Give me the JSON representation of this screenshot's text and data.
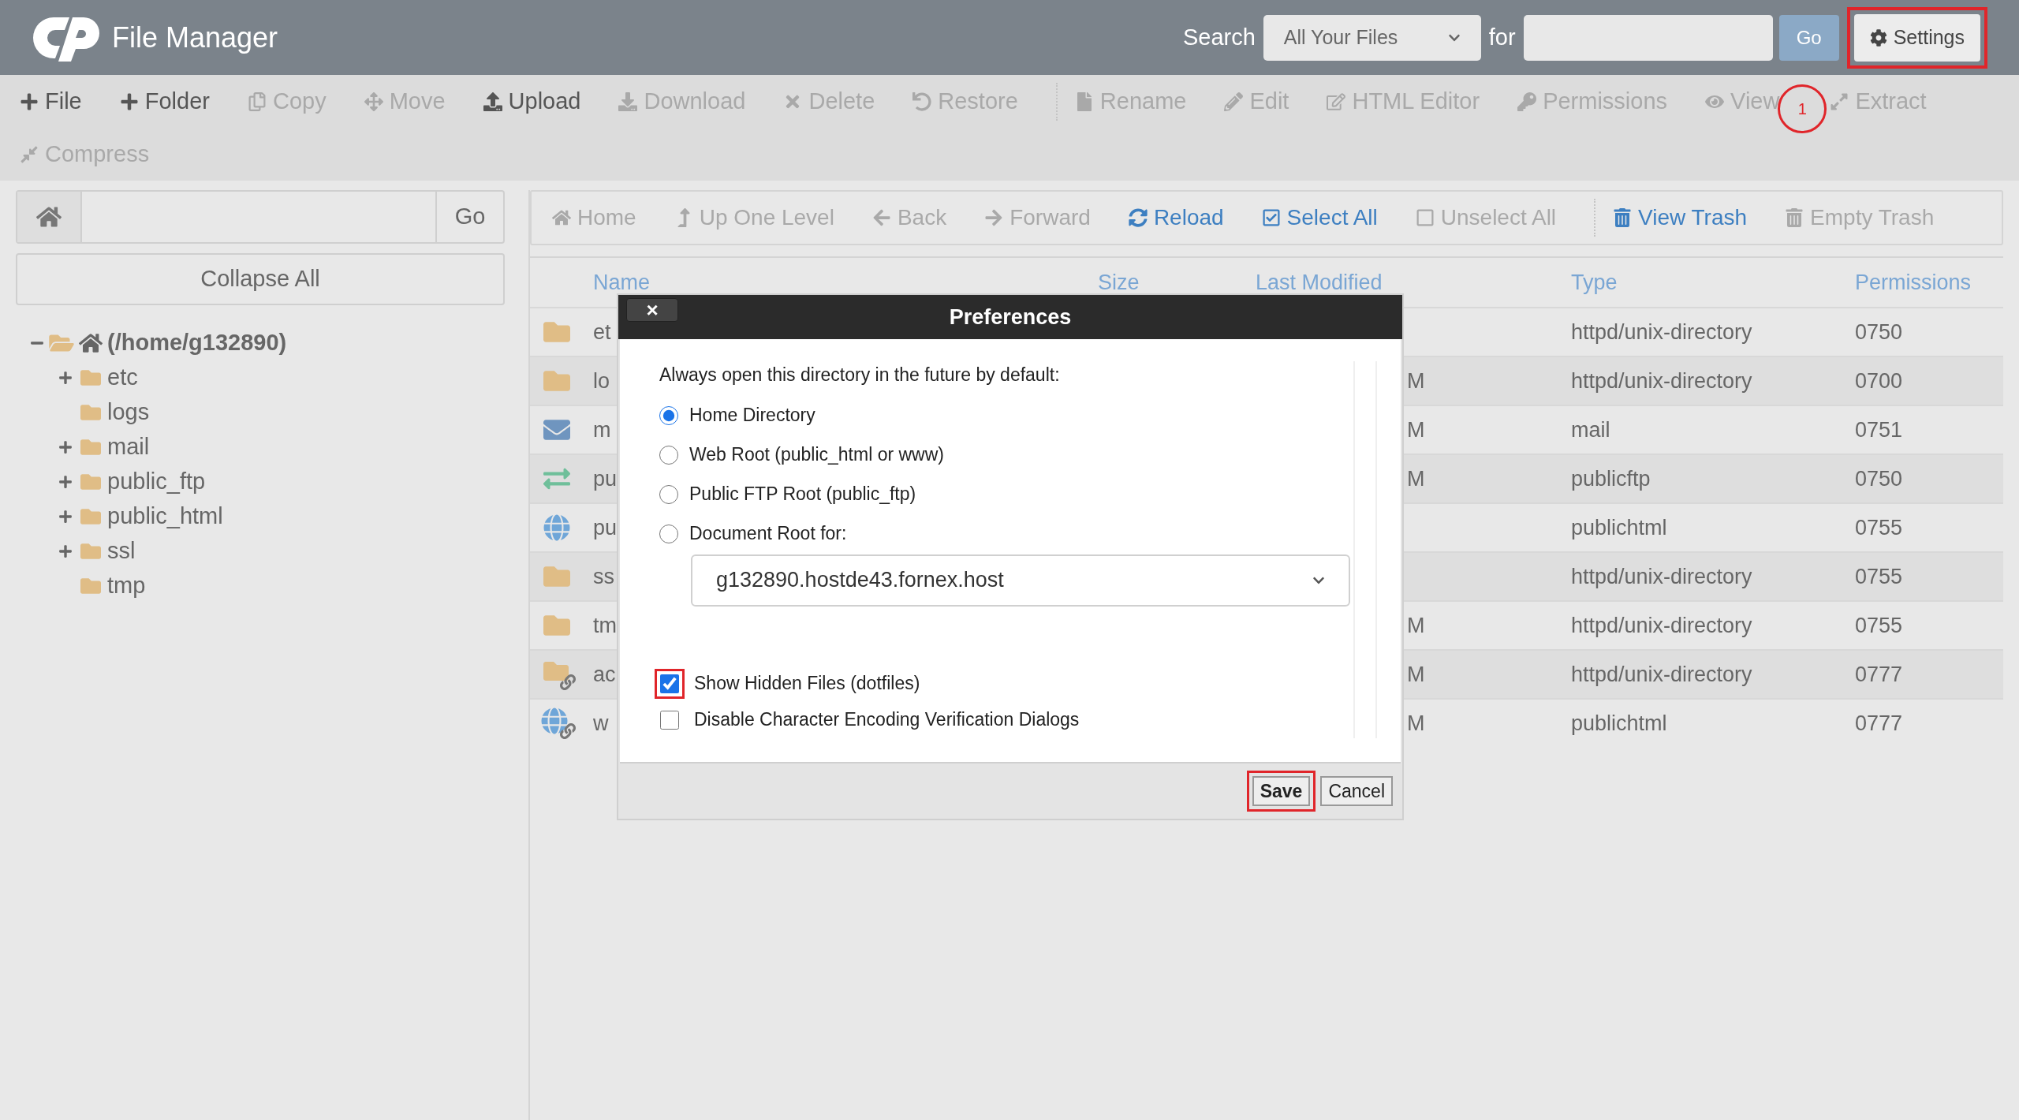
{
  "header": {
    "title": "File Manager",
    "search_label": "Search",
    "search_scope": "All Your Files",
    "for_label": "for",
    "go": "Go",
    "settings": {
      "label": "Settings",
      "highlighted": true
    }
  },
  "toolbar": [
    {
      "items": [
        {
          "label": "File",
          "disabled": false,
          "group_start": false
        },
        {
          "label": "Folder",
          "disabled": false,
          "group_start": false
        },
        {
          "label": "Copy",
          "disabled": true,
          "group_start": false
        },
        {
          "label": "Move",
          "disabled": true,
          "group_start": false
        },
        {
          "label": "Upload",
          "disabled": false,
          "group_start": false
        },
        {
          "label": "Download",
          "disabled": true,
          "group_start": false
        },
        {
          "label": "Delete",
          "disabled": true,
          "group_start": false
        },
        {
          "label": "Restore",
          "disabled": true,
          "group_start": false
        },
        {
          "label": "Rename",
          "disabled": true,
          "group_start": true
        },
        {
          "label": "Edit",
          "disabled": true,
          "group_start": false
        },
        {
          "label": "HTML Editor",
          "disabled": true,
          "group_start": false
        },
        {
          "label": "Permissions",
          "disabled": true,
          "group_start": false
        },
        {
          "label": "View",
          "disabled": true,
          "group_start": false
        },
        {
          "label": "Extract",
          "disabled": true,
          "group_start": false
        }
      ]
    },
    {
      "items": [
        {
          "label": "Compress",
          "disabled": true,
          "group_start": false
        }
      ]
    }
  ],
  "step_marker": "1",
  "sidebar": {
    "go": "Go",
    "collapse_all": "Collapse All",
    "tree": {
      "label": "(/home/g132890)",
      "expanded": true,
      "children": [
        {
          "label": "etc",
          "expandable": true
        },
        {
          "label": "logs",
          "expandable": false
        },
        {
          "label": "mail",
          "expandable": true
        },
        {
          "label": "public_ftp",
          "expandable": true
        },
        {
          "label": "public_html",
          "expandable": true
        },
        {
          "label": "ssl",
          "expandable": true
        },
        {
          "label": "tmp",
          "expandable": false
        }
      ]
    }
  },
  "nav": [
    {
      "label": "Home",
      "disabled": true,
      "group_start": false
    },
    {
      "label": "Up One Level",
      "disabled": true,
      "group_start": false
    },
    {
      "label": "Back",
      "disabled": true,
      "group_start": false
    },
    {
      "label": "Forward",
      "disabled": true,
      "group_start": false
    },
    {
      "label": "Reload",
      "disabled": false,
      "group_start": false
    },
    {
      "label": "Select All",
      "disabled": false,
      "group_start": false
    },
    {
      "label": "Unselect All",
      "disabled": true,
      "group_start": false
    },
    {
      "label": "View Trash",
      "disabled": false,
      "group_start": true
    },
    {
      "label": "Empty Trash",
      "disabled": true,
      "group_start": false
    }
  ],
  "table": {
    "columns": [
      "Name",
      "Size",
      "Last Modified",
      "Type",
      "Permissions"
    ],
    "rows": [
      {
        "kind": "folder",
        "name": "et",
        "modified": "",
        "type": "httpd/unix-directory",
        "permissions": "0750"
      },
      {
        "kind": "folder",
        "name": "lo",
        "modified": "M",
        "type": "httpd/unix-directory",
        "permissions": "0700"
      },
      {
        "kind": "mail",
        "name": "m",
        "modified": "M",
        "type": "mail",
        "permissions": "0751"
      },
      {
        "kind": "ftp",
        "name": "pu",
        "modified": "M",
        "type": "publicftp",
        "permissions": "0750"
      },
      {
        "kind": "web",
        "name": "pu",
        "modified": "",
        "type": "publichtml",
        "permissions": "0755"
      },
      {
        "kind": "folder",
        "name": "ss",
        "modified": "",
        "type": "httpd/unix-directory",
        "permissions": "0755"
      },
      {
        "kind": "folder",
        "name": "tm",
        "modified": "M",
        "type": "httpd/unix-directory",
        "permissions": "0755"
      },
      {
        "kind": "folder_link",
        "name": "ac",
        "modified": "M",
        "type": "httpd/unix-directory",
        "permissions": "0777"
      },
      {
        "kind": "web_link",
        "name": "w",
        "modified": "M",
        "type": "publichtml",
        "permissions": "0777"
      }
    ]
  },
  "dialog": {
    "title": "Preferences",
    "close": "×",
    "intro": "Always open this directory in the future by default:",
    "radios": [
      {
        "label": "Home Directory",
        "selected": true
      },
      {
        "label": "Web Root (public_html or www)",
        "selected": false
      },
      {
        "label": "Public FTP Root (public_ftp)",
        "selected": false
      },
      {
        "label": "Document Root for:",
        "selected": false
      }
    ],
    "domain_select": "g132890.hostde43.fornex.host",
    "checkboxes": [
      {
        "label": "Show Hidden Files (dotfiles)",
        "checked": true,
        "highlighted": true
      },
      {
        "label": "Disable Character Encoding Verification Dialogs",
        "checked": false,
        "highlighted": false
      }
    ],
    "save": {
      "label": "Save",
      "highlighted": true
    },
    "cancel": "Cancel"
  }
}
